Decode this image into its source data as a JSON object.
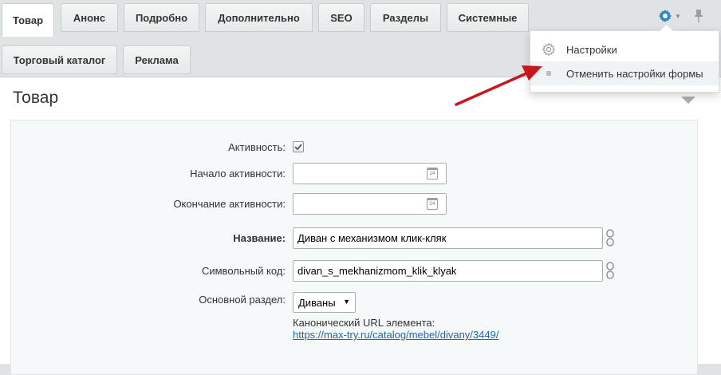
{
  "tabs_row1": [
    {
      "label": "Товар",
      "active": true
    },
    {
      "label": "Анонс",
      "active": false
    },
    {
      "label": "Подробно",
      "active": false
    },
    {
      "label": "Дополнительно",
      "active": false
    },
    {
      "label": "SEO",
      "active": false
    },
    {
      "label": "Разделы",
      "active": false
    },
    {
      "label": "Системные",
      "active": false
    }
  ],
  "tabs_row2": [
    {
      "label": "Торговый каталог"
    },
    {
      "label": "Реклама"
    }
  ],
  "settings_menu": {
    "items": [
      {
        "label": "Настройки",
        "icon": "gear-icon"
      },
      {
        "label": "Отменить настройки формы",
        "icon": "bullet-icon"
      }
    ]
  },
  "panel": {
    "title": "Товар"
  },
  "form": {
    "active_label": "Активность:",
    "active_checked": true,
    "start_label": "Начало активности:",
    "start_value": "",
    "end_label": "Окончание активности:",
    "end_value": "",
    "calendar_day": "24",
    "name_label": "Название:",
    "name_value": "Диван с механизмом клик-кляк",
    "code_label": "Символьный код:",
    "code_value": "divan_s_mekhanizmom_klik_klyak",
    "section_label": "Основной раздел:",
    "section_value": "Диваны",
    "canonical_label": "Канонический URL элемента:",
    "canonical_url": "https://max-try.ru/catalog/mebel/divany/3449/"
  },
  "colors": {
    "accent_blue": "#2e86c9",
    "annotation_arrow": "#c8161d",
    "link": "#2067b0"
  }
}
